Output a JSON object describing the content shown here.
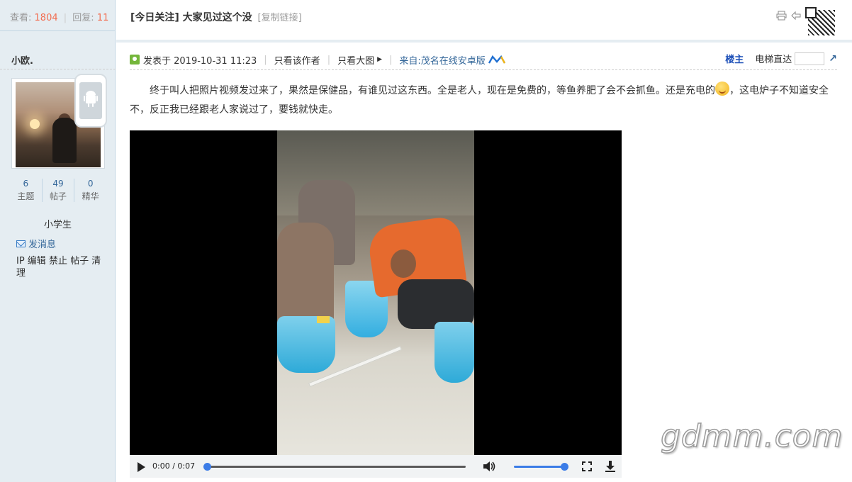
{
  "topbar": {
    "views_label": "查看:",
    "views": "1804",
    "replies_label": "回复:",
    "replies": "11"
  },
  "user": {
    "name": "小欧.",
    "stats": [
      {
        "value": "6",
        "label": "主题"
      },
      {
        "value": "49",
        "label": "帖子"
      },
      {
        "value": "0",
        "label": "精华"
      }
    ],
    "rank": "小学生",
    "send_message": "发消息",
    "admin_links": "IP 编辑 禁止 帖子 清理"
  },
  "thread": {
    "title": "[今日关注] 大家见过这个没",
    "copy_link": "[复制链接]"
  },
  "post": {
    "posted_at": "发表于 2019-10-31 11:23",
    "only_author": "只看该作者",
    "big_image": "只看大图",
    "source": "来自:茂名在线安卓版",
    "floor_label": "楼主",
    "jump_label": "电梯直达",
    "content_part1": "终于叫人把照片视频发过来了，果然是保健品，有谁见过这东西。全是老人，现在是免费的，等鱼养肥了会不会抓鱼。还是充电的",
    "content_part2": "，这电炉子不知道安全不，反正我已经跟老人家说过了，要钱就快走。"
  },
  "video": {
    "time": "0:00 / 0:07",
    "progress": 0.0,
    "volume": 1.0
  },
  "watermark": "gdmm.com",
  "colors": {
    "accent_red": "#f26c4f",
    "link_blue": "#336699",
    "floor_blue": "#1c4fb8",
    "player_blue": "#3b7ce7",
    "sidebar_bg": "#e5edf2"
  }
}
